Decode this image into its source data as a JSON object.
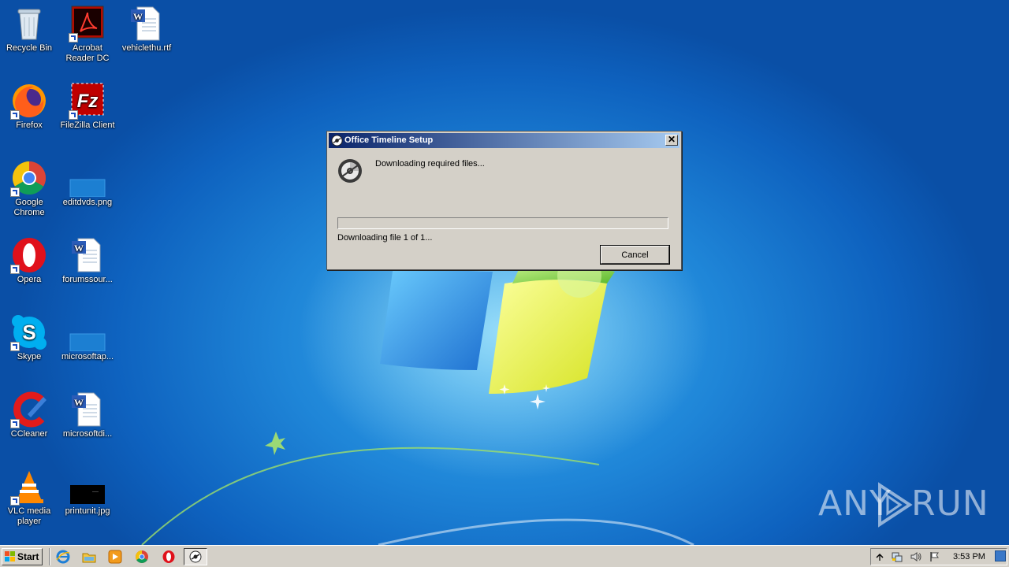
{
  "desktop": {
    "icons": [
      {
        "label": "Recycle Bin",
        "icon": "recycle-bin-icon"
      },
      {
        "label": "Acrobat Reader DC",
        "icon": "acrobat-icon"
      },
      {
        "label": "vehiclethu.rtf",
        "icon": "word-document-icon"
      },
      {
        "label": "Firefox",
        "icon": "firefox-icon"
      },
      {
        "label": "FileZilla Client",
        "icon": "filezilla-icon"
      },
      {
        "label": "Google Chrome",
        "icon": "chrome-icon"
      },
      {
        "label": "editdvds.png",
        "icon": "image-file-icon"
      },
      {
        "label": "Opera",
        "icon": "opera-icon"
      },
      {
        "label": "forumssour...",
        "icon": "word-document-icon"
      },
      {
        "label": "Skype",
        "icon": "skype-icon"
      },
      {
        "label": "microsoftap...",
        "icon": "image-file-icon"
      },
      {
        "label": "CCleaner",
        "icon": "ccleaner-icon"
      },
      {
        "label": "microsoftdi...",
        "icon": "word-document-icon"
      },
      {
        "label": "VLC media player",
        "icon": "vlc-icon"
      },
      {
        "label": "printunit.jpg",
        "icon": "image-file-icon"
      }
    ]
  },
  "dialog": {
    "title": "Office Timeline Setup",
    "close_label": "✕",
    "message": "Downloading required files...",
    "progress": 0,
    "status": "Downloading file 1 of 1...",
    "cancel_label": "Cancel"
  },
  "watermark": {
    "left": "ANY",
    "right": "RUN"
  },
  "taskbar": {
    "start_label": "Start",
    "quick_launch": [
      "internet-explorer-icon",
      "explorer-folder-icon",
      "media-player-icon",
      "chrome-icon",
      "opera-icon"
    ],
    "active_task_icon": "setup-disc-icon",
    "tray_icons": [
      "show-hidden-icons-chevron",
      "network-icon",
      "volume-icon",
      "action-center-flag-icon"
    ],
    "clock": "3:53 PM"
  },
  "colors": {
    "desktop_blue": "#1f86d8",
    "titlebar_start": "#0a246a",
    "titlebar_end": "#a6caf0",
    "dialog_face": "#d4d0c8"
  }
}
